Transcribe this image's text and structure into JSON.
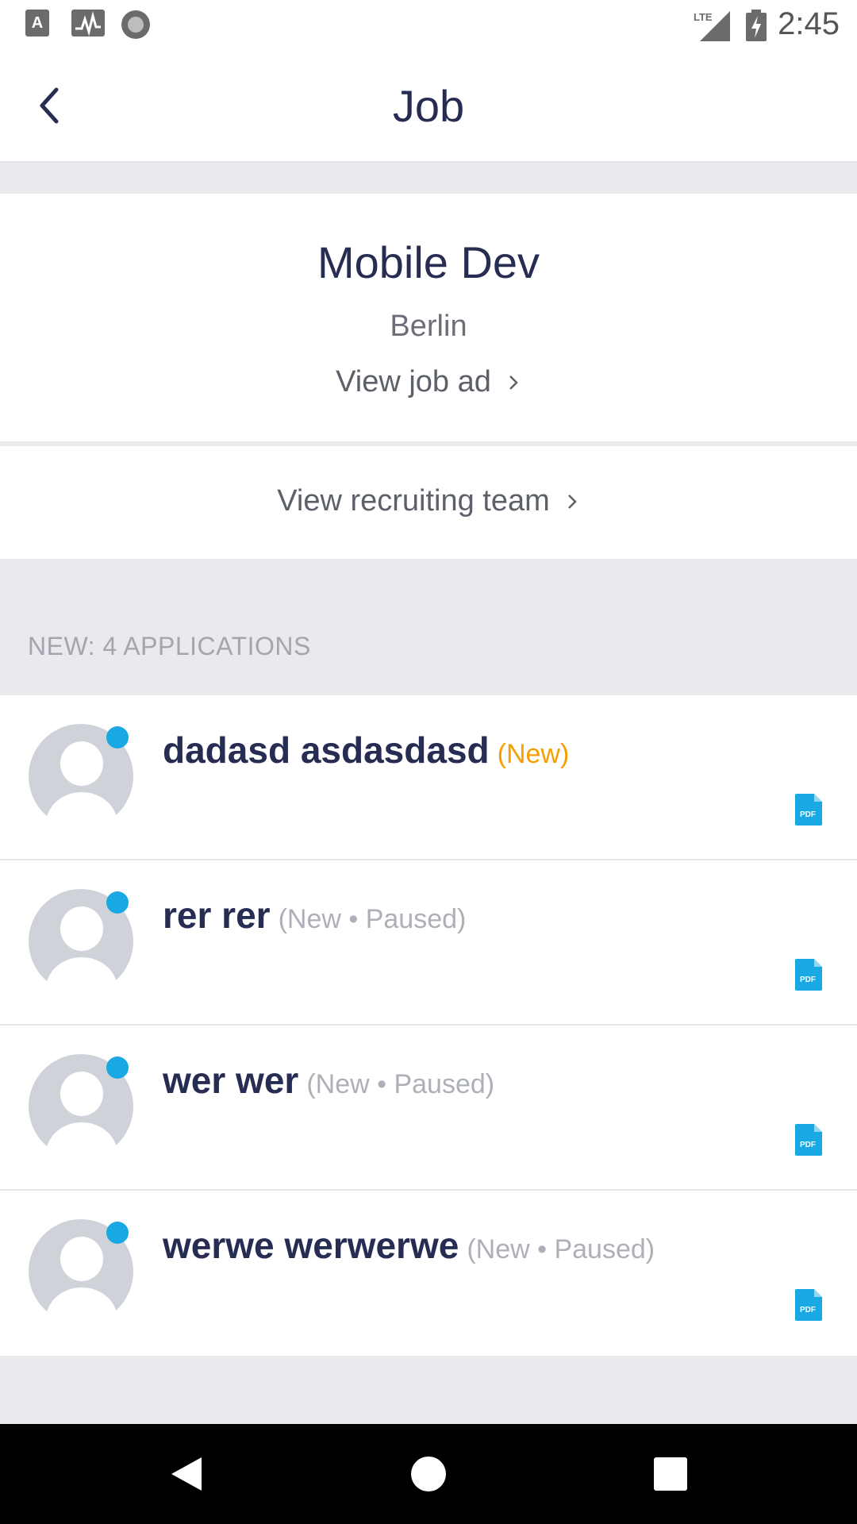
{
  "status_bar": {
    "time": "2:45",
    "left_icons": [
      "a-notification-icon",
      "activity-icon",
      "record-icon"
    ],
    "right_icons": [
      "lte-signal-icon",
      "battery-charging-icon"
    ]
  },
  "app_bar": {
    "title": "Job",
    "back_icon": "chevron-left-icon"
  },
  "job": {
    "title": "Mobile Dev",
    "location": "Berlin",
    "view_ad_label": "View job ad",
    "view_team_label": "View recruiting team"
  },
  "applications": {
    "section_header": "NEW: 4 APPLICATIONS",
    "items": [
      {
        "name": "dadasd asdasdasd",
        "status": "(New)",
        "status_color": "#f5a000"
      },
      {
        "name": "rer rer",
        "status": "(New • Paused)",
        "status_color": "#adb0b7"
      },
      {
        "name": "wer wer",
        "status": "(New • Paused)",
        "status_color": "#adb0b7"
      },
      {
        "name": "werwe werwerwe",
        "status": "(New • Paused)",
        "status_color": "#adb0b7"
      }
    ]
  },
  "colors": {
    "primary_text": "#262c52",
    "accent_blue": "#18a8e4",
    "new_status": "#f5a000"
  },
  "nav_bar": {
    "buttons": [
      "back-nav-icon",
      "home-nav-icon",
      "recents-nav-icon"
    ]
  }
}
